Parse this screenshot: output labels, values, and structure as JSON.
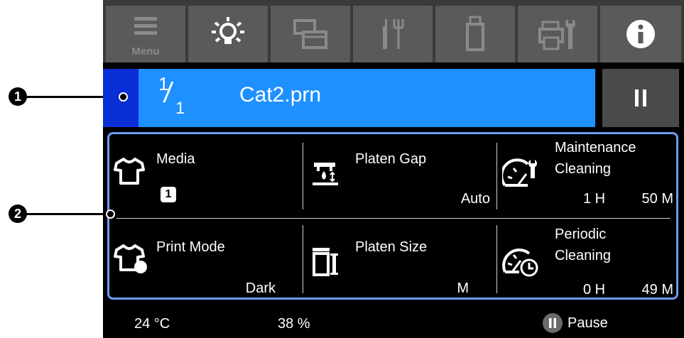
{
  "callouts": [
    "1",
    "2"
  ],
  "toolbar": {
    "menu_label": "Menu",
    "icons": [
      "menu-icon",
      "light-bulb-icon",
      "windows-icon",
      "tools-icon",
      "usb-drive-icon",
      "printer-settings-icon",
      "info-icon"
    ]
  },
  "job": {
    "current": "1",
    "total": "1",
    "file_name": "Cat2.prn"
  },
  "settings": {
    "media": {
      "label": "Media",
      "value": "1"
    },
    "platen_gap": {
      "label": "Platen Gap",
      "value": "Auto"
    },
    "maintenance": {
      "label_line1": "Maintenance",
      "label_line2": "Cleaning",
      "hours": "1 H",
      "minutes": "50 M"
    },
    "print_mode": {
      "label": "Print Mode",
      "value": "Dark"
    },
    "platen_size": {
      "label": "Platen Size",
      "value": "M"
    },
    "periodic": {
      "label_line1": "Periodic",
      "label_line2": "Cleaning",
      "hours": "0 H",
      "minutes": "49 M"
    }
  },
  "status": {
    "temperature": "24 °C",
    "humidity": "38 %",
    "pause_label": "Pause"
  },
  "colors": {
    "job_bar": "#1e90ff",
    "job_tab": "#0b2fd6",
    "panel_border": "#6b9cf2",
    "toolbar_button": "#5a5a5a"
  }
}
